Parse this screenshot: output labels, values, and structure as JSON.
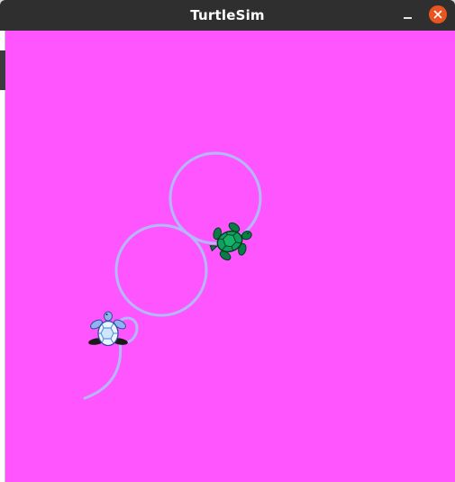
{
  "window": {
    "title": "TurtleSim",
    "minimize_icon": "minimize-icon",
    "close_icon": "close-icon",
    "close_color": "#e95420",
    "titlebar_color": "#2f2f2f"
  },
  "canvas": {
    "background_color": "#ff55ff",
    "trail_color": "#b3b8ff",
    "turtles": [
      {
        "name": "turtle-green",
        "color": "#0fa060"
      },
      {
        "name": "turtle-blue",
        "color": "#cfe6ff"
      }
    ]
  }
}
